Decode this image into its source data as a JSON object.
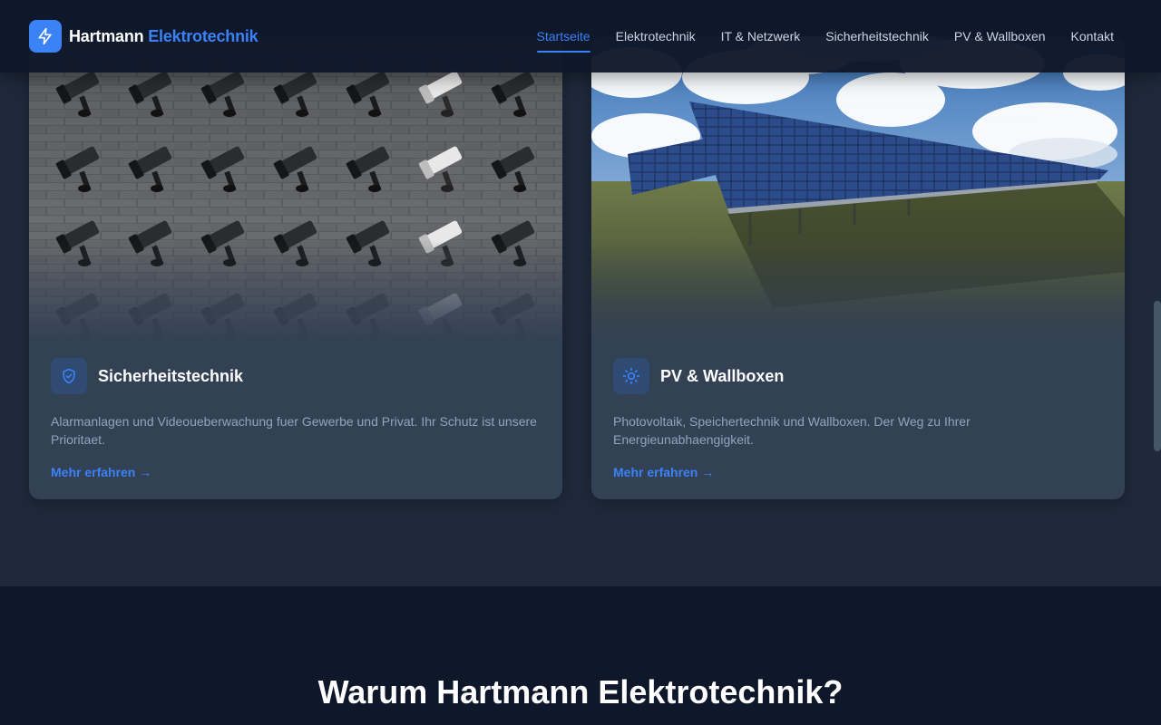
{
  "brand": {
    "name_part1": "Hartmann",
    "name_part2": "Elektrotechnik"
  },
  "nav": {
    "items": [
      {
        "label": "Startseite",
        "active": true
      },
      {
        "label": "Elektrotechnik"
      },
      {
        "label": "IT & Netzwerk"
      },
      {
        "label": "Sicherheitstechnik"
      },
      {
        "label": "PV & Wallboxen"
      },
      {
        "label": "Kontakt"
      }
    ]
  },
  "cards": [
    {
      "title": "Sicherheitstechnik",
      "description": "Alarmanlagen und Videoueberwachung fuer Gewerbe und Privat. Ihr Schutz ist unsere Prioritaet.",
      "link": "Mehr erfahren →",
      "icon": "shield-check-icon"
    },
    {
      "title": "PV & Wallboxen",
      "description": "Photovoltaik, Speichertechnik und Wallboxen. Der Weg zu Ihrer Energieunabhaengigkeit.",
      "link": "Mehr erfahren →",
      "icon": "sun-icon"
    }
  ],
  "why": {
    "title": "Warum Hartmann Elektrotechnik?"
  },
  "colors": {
    "accent": "#3b82f6",
    "header_bg": "#0f172a",
    "card_bg": "#334155",
    "section_bg": "#1e293b"
  }
}
